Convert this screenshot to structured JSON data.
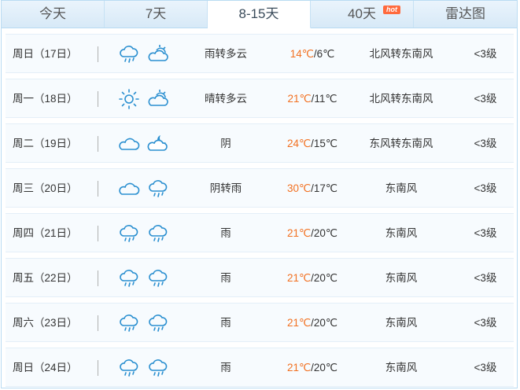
{
  "tabs": [
    {
      "label": "今天",
      "active": false
    },
    {
      "label": "7天",
      "active": false
    },
    {
      "label": "8-15天",
      "active": true
    },
    {
      "label": "40天",
      "active": false,
      "badge": "hot"
    },
    {
      "label": "雷达图",
      "active": false
    }
  ],
  "colors": {
    "accent_temp": "#f27020",
    "tab_bg": "#dfeefa",
    "border": "#b9dbf2",
    "icon_stroke": "#2a8fd0"
  },
  "forecast": [
    {
      "day": "周日（17日）",
      "icon1": "rain",
      "icon2": "partly-cloudy",
      "weather": "雨转多云",
      "tmax": "14℃",
      "tmin": "/6℃",
      "wind": "北风转东南风",
      "level": "<3级"
    },
    {
      "day": "周一（18日）",
      "icon1": "sunny",
      "icon2": "partly-cloudy",
      "weather": "晴转多云",
      "tmax": "21℃",
      "tmin": "/11℃",
      "wind": "北风转东南风",
      "level": "<3级"
    },
    {
      "day": "周二（19日）",
      "icon1": "overcast",
      "icon2": "cloudy-night",
      "weather": "阴",
      "tmax": "24℃",
      "tmin": "/15℃",
      "wind": "东风转东南风",
      "level": "<3级"
    },
    {
      "day": "周三（20日）",
      "icon1": "overcast",
      "icon2": "rain",
      "weather": "阴转雨",
      "tmax": "30℃",
      "tmin": "/17℃",
      "wind": "东南风",
      "level": "<3级"
    },
    {
      "day": "周四（21日）",
      "icon1": "rain",
      "icon2": "rain",
      "weather": "雨",
      "tmax": "21℃",
      "tmin": "/20℃",
      "wind": "东南风",
      "level": "<3级"
    },
    {
      "day": "周五（22日）",
      "icon1": "rain",
      "icon2": "rain",
      "weather": "雨",
      "tmax": "21℃",
      "tmin": "/20℃",
      "wind": "东南风",
      "level": "<3级"
    },
    {
      "day": "周六（23日）",
      "icon1": "rain",
      "icon2": "rain",
      "weather": "雨",
      "tmax": "21℃",
      "tmin": "/20℃",
      "wind": "东南风",
      "level": "<3级"
    },
    {
      "day": "周日（24日）",
      "icon1": "rain",
      "icon2": "rain",
      "weather": "雨",
      "tmax": "21℃",
      "tmin": "/20℃",
      "wind": "东南风",
      "level": "<3级"
    }
  ]
}
